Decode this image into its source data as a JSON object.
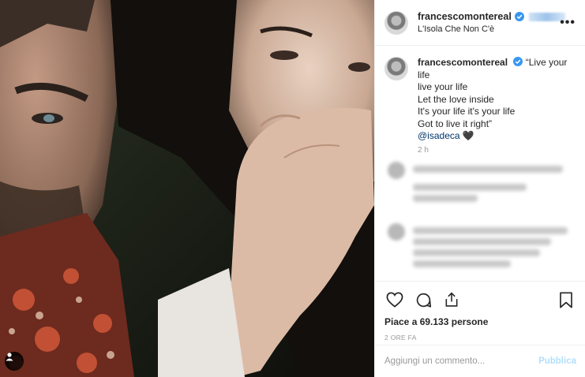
{
  "post": {
    "username": "francescomontereal",
    "location": "L'Isola Che Non C'è",
    "more_label": "•••"
  },
  "caption": {
    "username": "francescomontereal",
    "lines": [
      "“Live your life",
      "live your life",
      "Let the love inside",
      "It's your life it's your life",
      "Got to live it right”"
    ],
    "mention": "@isadeca",
    "heart": "🖤",
    "time": "2 h"
  },
  "likes": "Piace a 69.133 persone",
  "timestamp": "2 ORE FA",
  "comment_box": {
    "placeholder": "Aggiungi un commento...",
    "publish_label": "Pubblica"
  },
  "icons": {
    "like": "heart-outline-icon",
    "comment": "speech-bubble-icon",
    "share": "share-icon",
    "save": "bookmark-icon",
    "verified": "verified-badge-icon",
    "tag": "user-tag-icon"
  },
  "colors": {
    "verified": "#3897f0",
    "mention": "#003569",
    "publish_disabled": "#b2dffc",
    "muted": "#999999"
  }
}
